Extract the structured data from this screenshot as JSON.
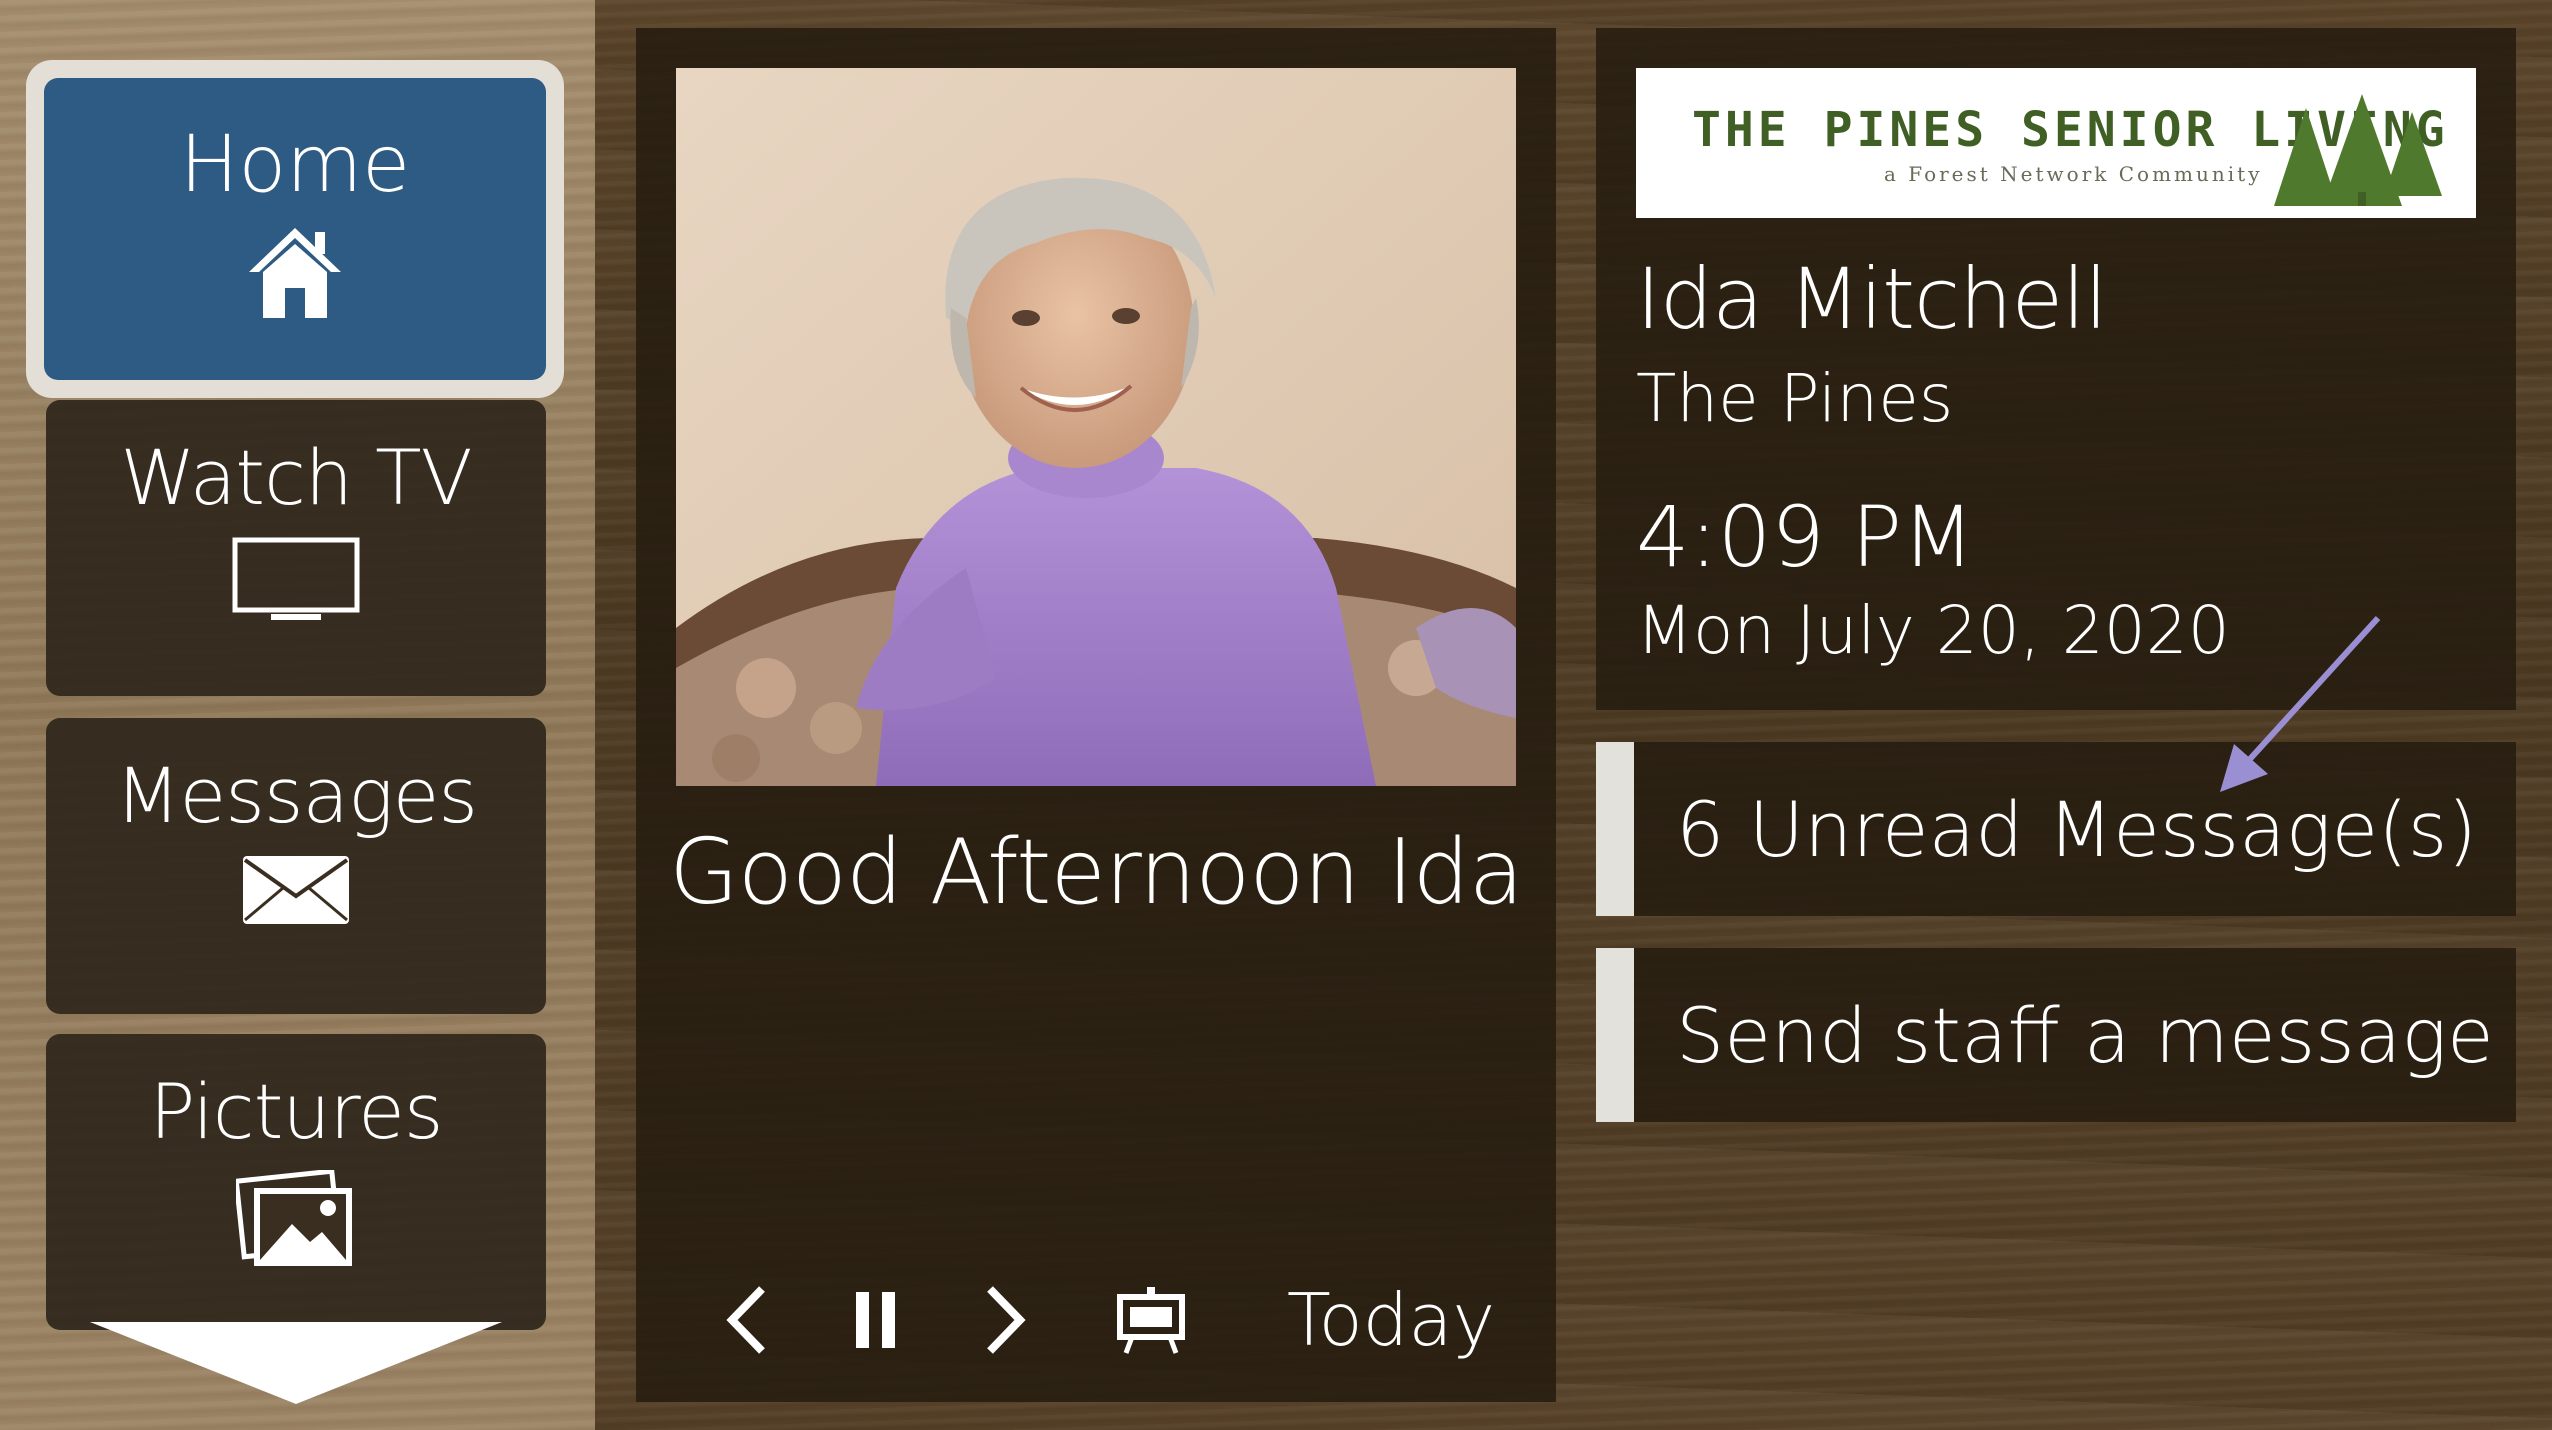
{
  "nav": {
    "items": [
      {
        "label": "Home",
        "icon": "home-icon",
        "active": true
      },
      {
        "label": "Watch TV",
        "icon": "tv-icon"
      },
      {
        "label": "Messages",
        "icon": "envelope-icon"
      },
      {
        "label": "Pictures",
        "icon": "pictures-icon"
      }
    ],
    "more_icon": "chevron-down-icon"
  },
  "slideshow": {
    "greeting": "Good Afternoon Ida",
    "photo_icon": "resident-photo",
    "controls": {
      "prev_icon": "chevron-left-icon",
      "pause_icon": "pause-icon",
      "next_icon": "chevron-right-icon",
      "display_icon": "easel-icon",
      "today_label": "Today"
    }
  },
  "logo": {
    "title": "THE PINES SENIOR LIVING",
    "subtitle": "a Forest Network Community",
    "color": "#3f5f24"
  },
  "resident": {
    "name": "Ida Mitchell",
    "community": "The Pines",
    "time": "4:09 PM",
    "date": "Mon July 20, 2020"
  },
  "messages": {
    "unread_label": "6 Unread Message(s)",
    "send_label": "Send staff a message"
  },
  "colors": {
    "active_tile": "#2e5b83",
    "arrow": "#9b8fd3"
  }
}
